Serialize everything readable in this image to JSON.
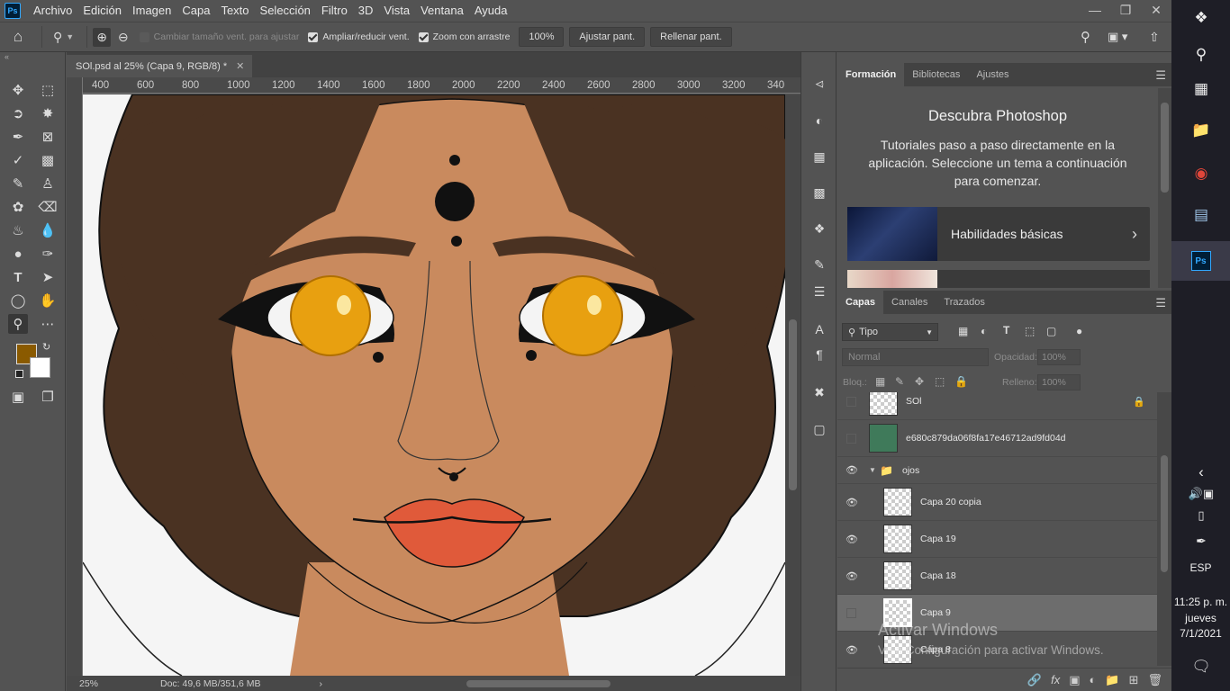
{
  "app": {
    "logo": "Ps"
  },
  "menu": [
    "Archivo",
    "Edición",
    "Imagen",
    "Capa",
    "Texto",
    "Selección",
    "Filtro",
    "3D",
    "Vista",
    "Ventana",
    "Ayuda"
  ],
  "options": {
    "resize_windows": "Cambiar tamaño vent. para ajustar",
    "zoom_all": "Ampliar/reducir vent.",
    "scrubby_zoom": "Zoom con arrastre",
    "zoom_value": "100%",
    "fit_screen": "Ajustar pant.",
    "fill_screen": "Rellenar pant."
  },
  "document": {
    "tab_title": "SOl.psd al 25% (Capa 9, RGB/8) *",
    "ruler_ticks": [
      "400",
      "600",
      "800",
      "1000",
      "1200",
      "1400",
      "1600",
      "1800",
      "2000",
      "2200",
      "2400",
      "2600",
      "2800",
      "3000",
      "3200",
      "340"
    ],
    "zoom": "25%",
    "doc_info": "Doc: 49,6 MB/351,6 MB"
  },
  "colors": {
    "foreground": "#8a5a00",
    "background": "#ffffff",
    "skin": "#c98a5e",
    "hair": "#4a3222",
    "iris": "#e8a010",
    "lips": "#e05a3a"
  },
  "learn_panel": {
    "tabs": [
      "Formación",
      "Bibliotecas",
      "Ajustes"
    ],
    "title": "Descubra Photoshop",
    "description": "Tutoriales paso a paso directamente en la aplicación. Seleccione un tema a continuación para comenzar.",
    "card": "Habilidades básicas"
  },
  "layers_panel": {
    "tabs": [
      "Capas",
      "Canales",
      "Trazados"
    ],
    "filter": "Tipo",
    "blend_mode": "Normal",
    "opacity_label": "Opacidad:",
    "opacity": "100%",
    "lock_label": "Bloq.:",
    "fill_label": "Relleno:",
    "fill": "100%",
    "layers": [
      {
        "name": "SOl",
        "visible": false,
        "locked": true
      },
      {
        "name": "e680c879da06f8fa17e46712ad9fd04d",
        "visible": false
      },
      {
        "name": "ojos",
        "visible": true,
        "group": true
      },
      {
        "name": "Capa 20 copia",
        "visible": true
      },
      {
        "name": "Capa 19",
        "visible": true
      },
      {
        "name": "Capa 18",
        "visible": true
      },
      {
        "name": "Capa 9",
        "visible": false,
        "selected": true
      },
      {
        "name": "Capa 8",
        "visible": true
      }
    ]
  },
  "watermark": {
    "line1": "Activar Windows",
    "line2": "Ve a Configuración para activar Windows."
  },
  "taskbar": {
    "lang": "ESP",
    "time": "11:25 p. m.",
    "day": "jueves",
    "date": "7/1/2021"
  }
}
